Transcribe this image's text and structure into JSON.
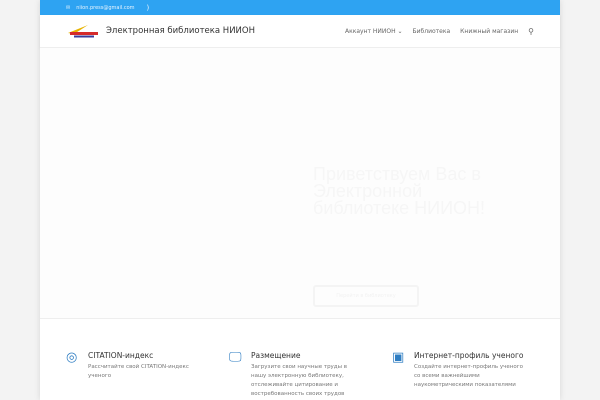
{
  "topbar": {
    "email": "niion.press@gmail.com"
  },
  "header": {
    "site_title": "Электронная библиотека НИИОН",
    "nav": [
      {
        "label": "Аккаунт НИИОН ⌄"
      },
      {
        "label": "Библиотека"
      },
      {
        "label": "Книжный магазин"
      }
    ]
  },
  "hero": {
    "title": "Приветствуем Вас в Электронной библиотеке НИИОН!",
    "button": "Перейти в библиотеку"
  },
  "features": [
    {
      "title": "CITATION-индекс",
      "desc": "Рассчитайте свой CITATION-индекс ученого",
      "icon": "◎"
    },
    {
      "title": "Размещение",
      "desc": "Загрузите свои научные труды в нашу электронную библиотеку, отслеживайте цитирование и востребованность своих трудов",
      "icon": "🖵"
    },
    {
      "title": "Интернет-профиль ученого",
      "desc": "Создайте интернет-профиль ученого со всеми важнейшими наукометрическими показателями",
      "icon": "▣"
    }
  ],
  "colors": {
    "accent": "#2ea3f2"
  }
}
